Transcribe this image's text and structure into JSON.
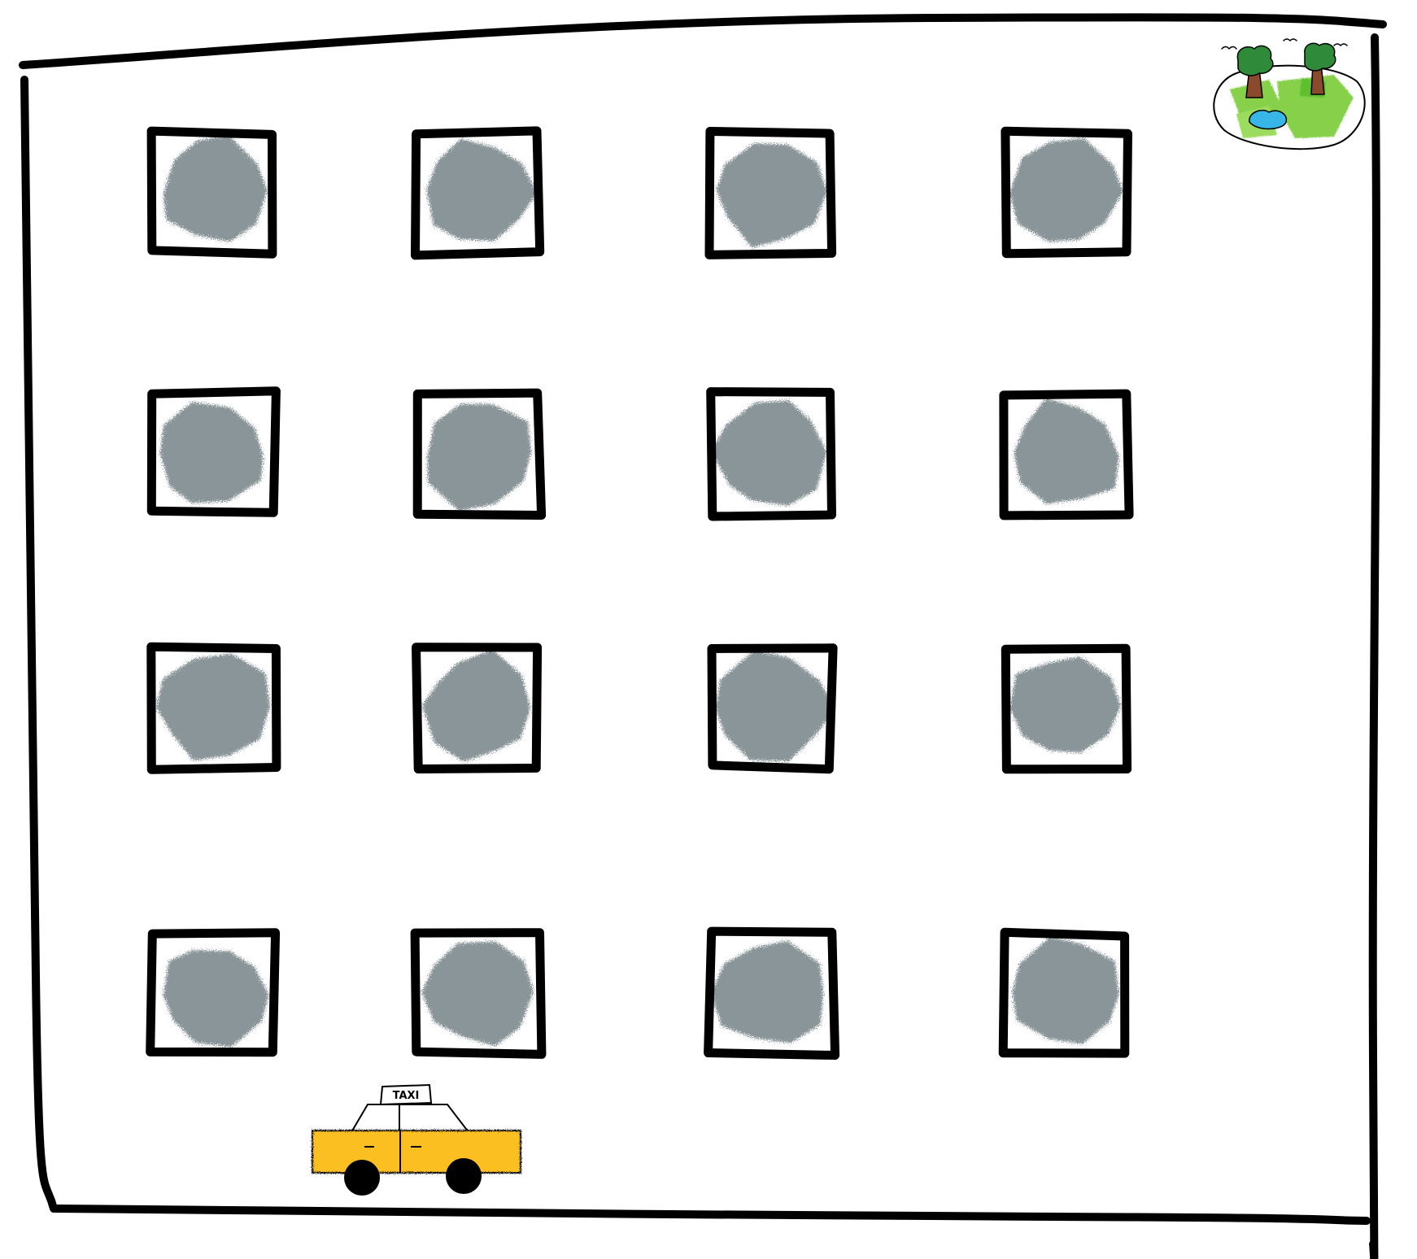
{
  "scene": {
    "grid": {
      "rows": 4,
      "columns": 4,
      "window_count": 16
    },
    "taxi": {
      "roof_sign": "TAXI"
    },
    "park": {
      "trees": 2,
      "pond": true,
      "birds": 3
    }
  },
  "colors": {
    "background": "#ffffff",
    "ink": "#000000",
    "window_fill": "#8a959a",
    "taxi_body": "#fbbf24",
    "grass": "#86d14a",
    "tree_canopy": "#2f8a3a",
    "tree_trunk": "#8b4a2b",
    "pond": "#38b6e8"
  }
}
